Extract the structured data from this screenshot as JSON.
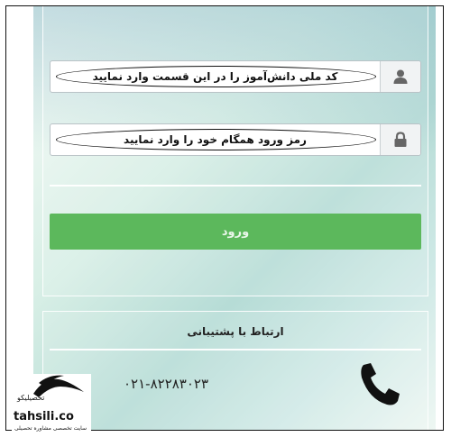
{
  "login": {
    "username_placeholder": "کد ملی دانش‌آموز را در این قسمت وارد نمایید",
    "password_placeholder": "رمز ورود همگام خود را وارد نمایید",
    "submit_label": "ورود"
  },
  "support": {
    "title": "ارتباط با پشتیبانی",
    "phone": "۰۲۱-۸۲۲۸۳۰۲۳"
  },
  "watermark": {
    "brand_fa": "تحصیلیکو",
    "brand_latin": "tahsili.co",
    "tagline": "سایت تخصصی مشاوره تحصیلی"
  },
  "icons": {
    "username": "user-icon",
    "password": "lock-icon",
    "support": "phone-icon"
  },
  "colors": {
    "login_button": "#5cb85c",
    "field_border": "#b9c2c6"
  }
}
